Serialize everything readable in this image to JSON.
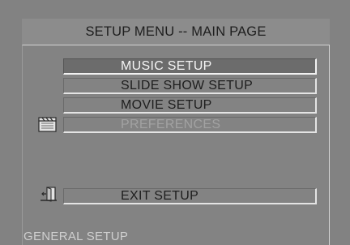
{
  "header": {
    "title": "SETUP MENU -- MAIN PAGE"
  },
  "menu": {
    "items": [
      {
        "label": "MUSIC SETUP",
        "state": "selected"
      },
      {
        "label": "SLIDE SHOW SETUP",
        "state": "normal"
      },
      {
        "label": "MOVIE SETUP",
        "state": "normal"
      },
      {
        "label": "PREFERENCES",
        "state": "disabled"
      }
    ],
    "exit": {
      "label": "EXIT SETUP"
    }
  },
  "icons": {
    "settings": "clapperboard-icon",
    "exit": "exit-door-icon"
  },
  "footer": {
    "status": "GENERAL SETUP"
  },
  "colors": {
    "background": "#828282",
    "selected_background": "#6c6c6c",
    "selected_text": "#f4f4f4",
    "text": "#1e1e1e",
    "disabled_text": "#a2a2a2"
  }
}
